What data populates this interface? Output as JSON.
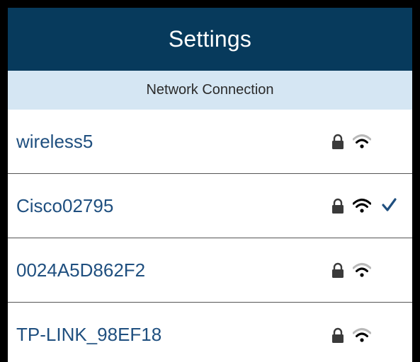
{
  "header": {
    "title": "Settings"
  },
  "section": {
    "title": "Network Connection"
  },
  "networks": [
    {
      "ssid": "wireless5",
      "secured": true,
      "signal": "low",
      "connected": false
    },
    {
      "ssid": "Cisco02795",
      "secured": true,
      "signal": "full",
      "connected": true
    },
    {
      "ssid": "0024A5D862F2",
      "secured": true,
      "signal": "low",
      "connected": false
    },
    {
      "ssid": "TP-LINK_98EF18",
      "secured": true,
      "signal": "low",
      "connected": false
    }
  ],
  "icons": {
    "lock": "lock-icon",
    "wifi": "wifi-signal-icon",
    "check": "checkmark-icon"
  },
  "colors": {
    "header_bg": "#073a5c",
    "section_bg": "#d5e6f3",
    "ssid_text": "#1f4f7f",
    "check": "#1f4f7f",
    "wifi_full": "#000000",
    "wifi_low_arc": "#b9b9b9"
  }
}
